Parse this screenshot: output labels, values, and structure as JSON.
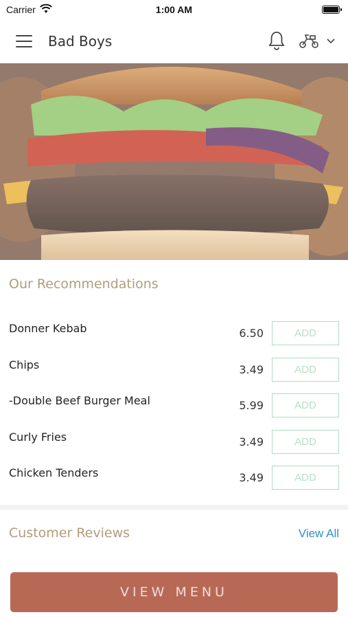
{
  "status_bar": {
    "carrier": "Carrier",
    "time": "1:00 AM"
  },
  "header": {
    "title": "Bad Boys",
    "icons": [
      "menu-icon",
      "bell-icon",
      "scooter-icon",
      "chevron-down-icon"
    ]
  },
  "recommendations": {
    "title": "Our Recommendations",
    "items": [
      {
        "name": "Donner Kebab",
        "price": "6.50",
        "add_label": "ADD"
      },
      {
        "name": "Chips",
        "price": "3.49",
        "add_label": "ADD"
      },
      {
        "name": "-Double Beef Burger Meal",
        "price": "5.99",
        "add_label": "ADD"
      },
      {
        "name": "Curly Fries",
        "price": "3.49",
        "add_label": "ADD"
      },
      {
        "name": "Chicken Tenders",
        "price": "3.49",
        "add_label": "ADD"
      }
    ]
  },
  "reviews": {
    "title": "Customer Reviews",
    "view_all_label": "View All"
  },
  "footer": {
    "view_menu_label": "VIEW MENU"
  },
  "colors": {
    "accent_gold": "#b29c7c",
    "add_green": "#aedcc2",
    "link_blue": "#2a93c6",
    "cta_terracotta": "#b76956"
  }
}
